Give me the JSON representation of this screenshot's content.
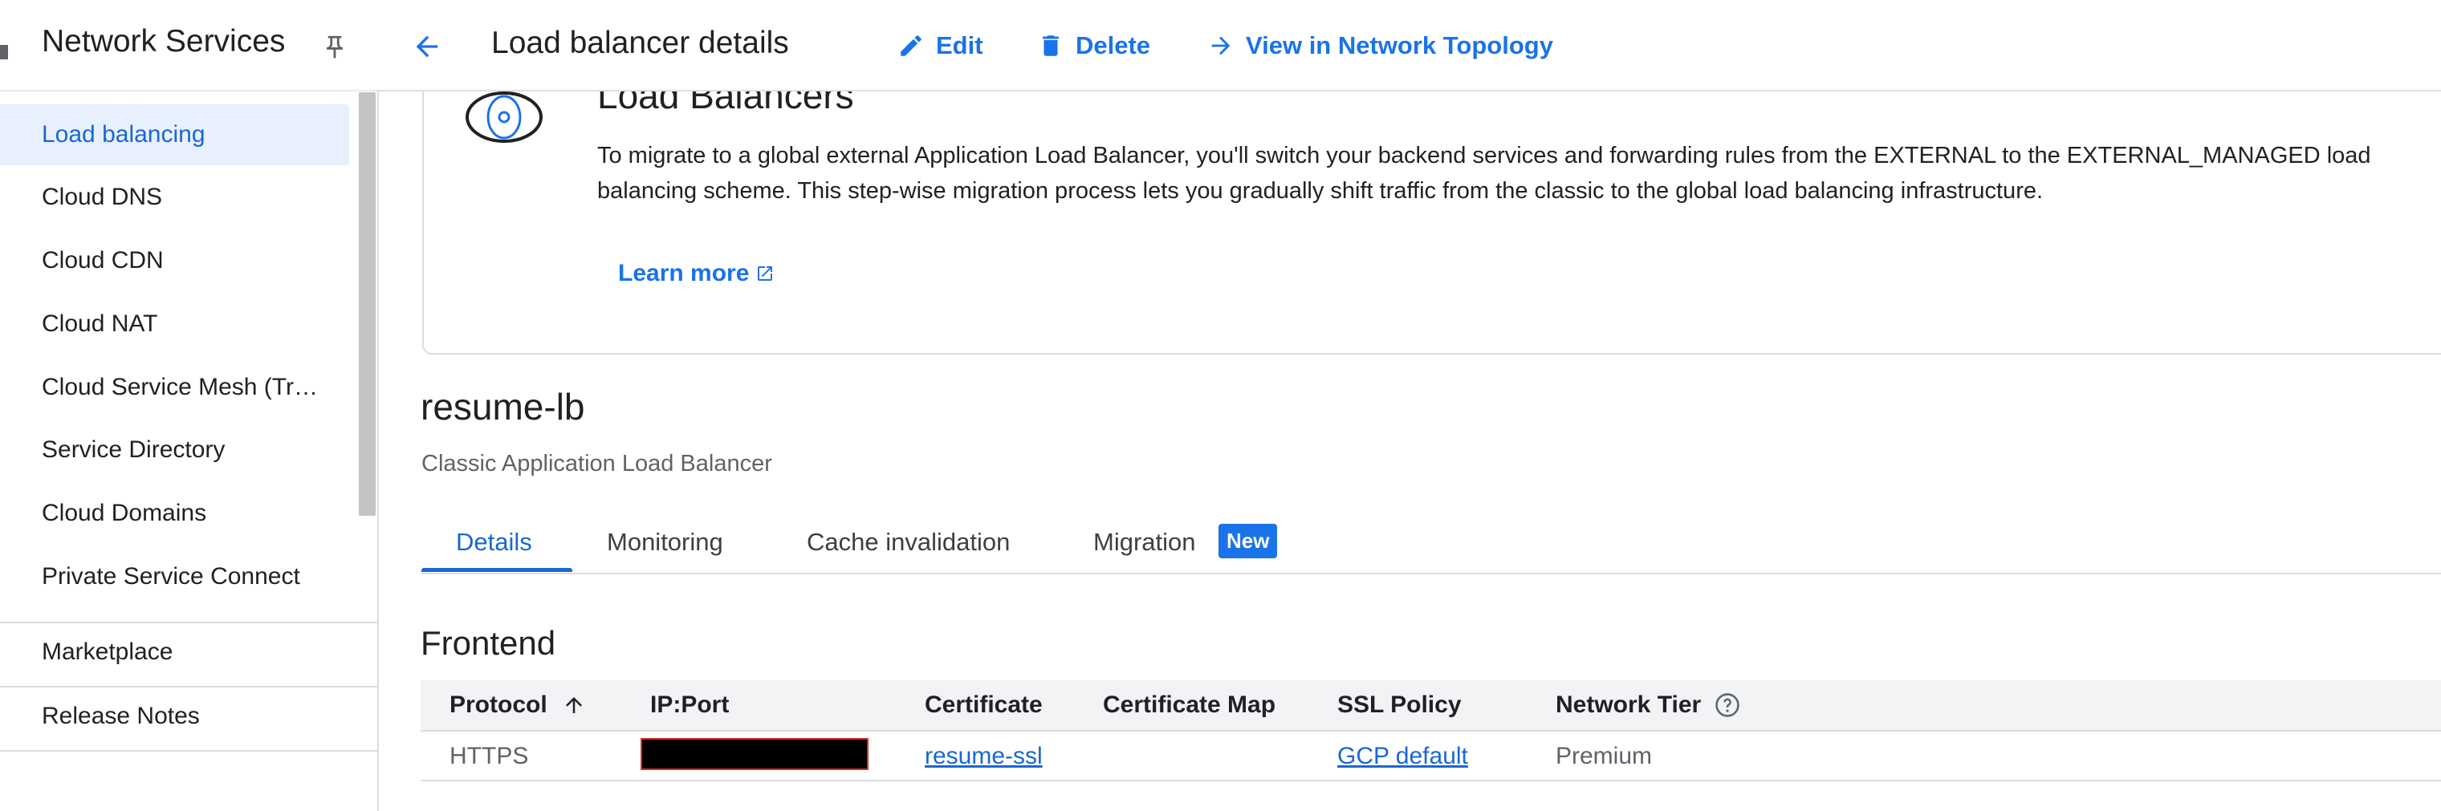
{
  "sidebar": {
    "title": "Network Services",
    "items": [
      {
        "label": "Load balancing"
      },
      {
        "label": "Cloud DNS"
      },
      {
        "label": "Cloud CDN"
      },
      {
        "label": "Cloud NAT"
      },
      {
        "label": "Cloud Service Mesh (Tr…"
      },
      {
        "label": "Service Directory"
      },
      {
        "label": "Cloud Domains"
      },
      {
        "label": "Private Service Connect"
      }
    ],
    "footer_items": [
      {
        "label": "Marketplace"
      },
      {
        "label": "Release Notes"
      }
    ]
  },
  "header": {
    "title": "Load balancer details",
    "edit_label": "Edit",
    "delete_label": "Delete",
    "topology_label": "View in Network Topology"
  },
  "banner": {
    "title": "Load Balancers",
    "text": "To migrate to a global external Application Load Balancer, you'll switch your backend services and forwarding rules from the EXTERNAL to the EXTERNAL_MANAGED load balancing scheme. This step-wise migration process lets you gradually shift traffic from the classic to the global load balancing infrastructure.",
    "learn_more": "Learn more"
  },
  "load_balancer": {
    "name": "resume-lb",
    "type": "Classic Application Load Balancer"
  },
  "tabs": [
    {
      "label": "Details"
    },
    {
      "label": "Monitoring"
    },
    {
      "label": "Cache invalidation"
    },
    {
      "label": "Migration"
    }
  ],
  "new_badge": "New",
  "frontend": {
    "title": "Frontend",
    "columns": [
      "Protocol",
      "IP:Port",
      "Certificate",
      "Certificate Map",
      "SSL Policy",
      "Network Tier"
    ],
    "rows": [
      {
        "protocol": "HTTPS",
        "ip_port": "",
        "certificate": "resume-ssl",
        "certificate_map": "",
        "ssl_policy": "GCP default",
        "network_tier": "Premium"
      }
    ]
  },
  "colors": {
    "accent": "#1a73e8",
    "active_nav_bg": "#e8f0fe",
    "redaction": "#000000"
  }
}
